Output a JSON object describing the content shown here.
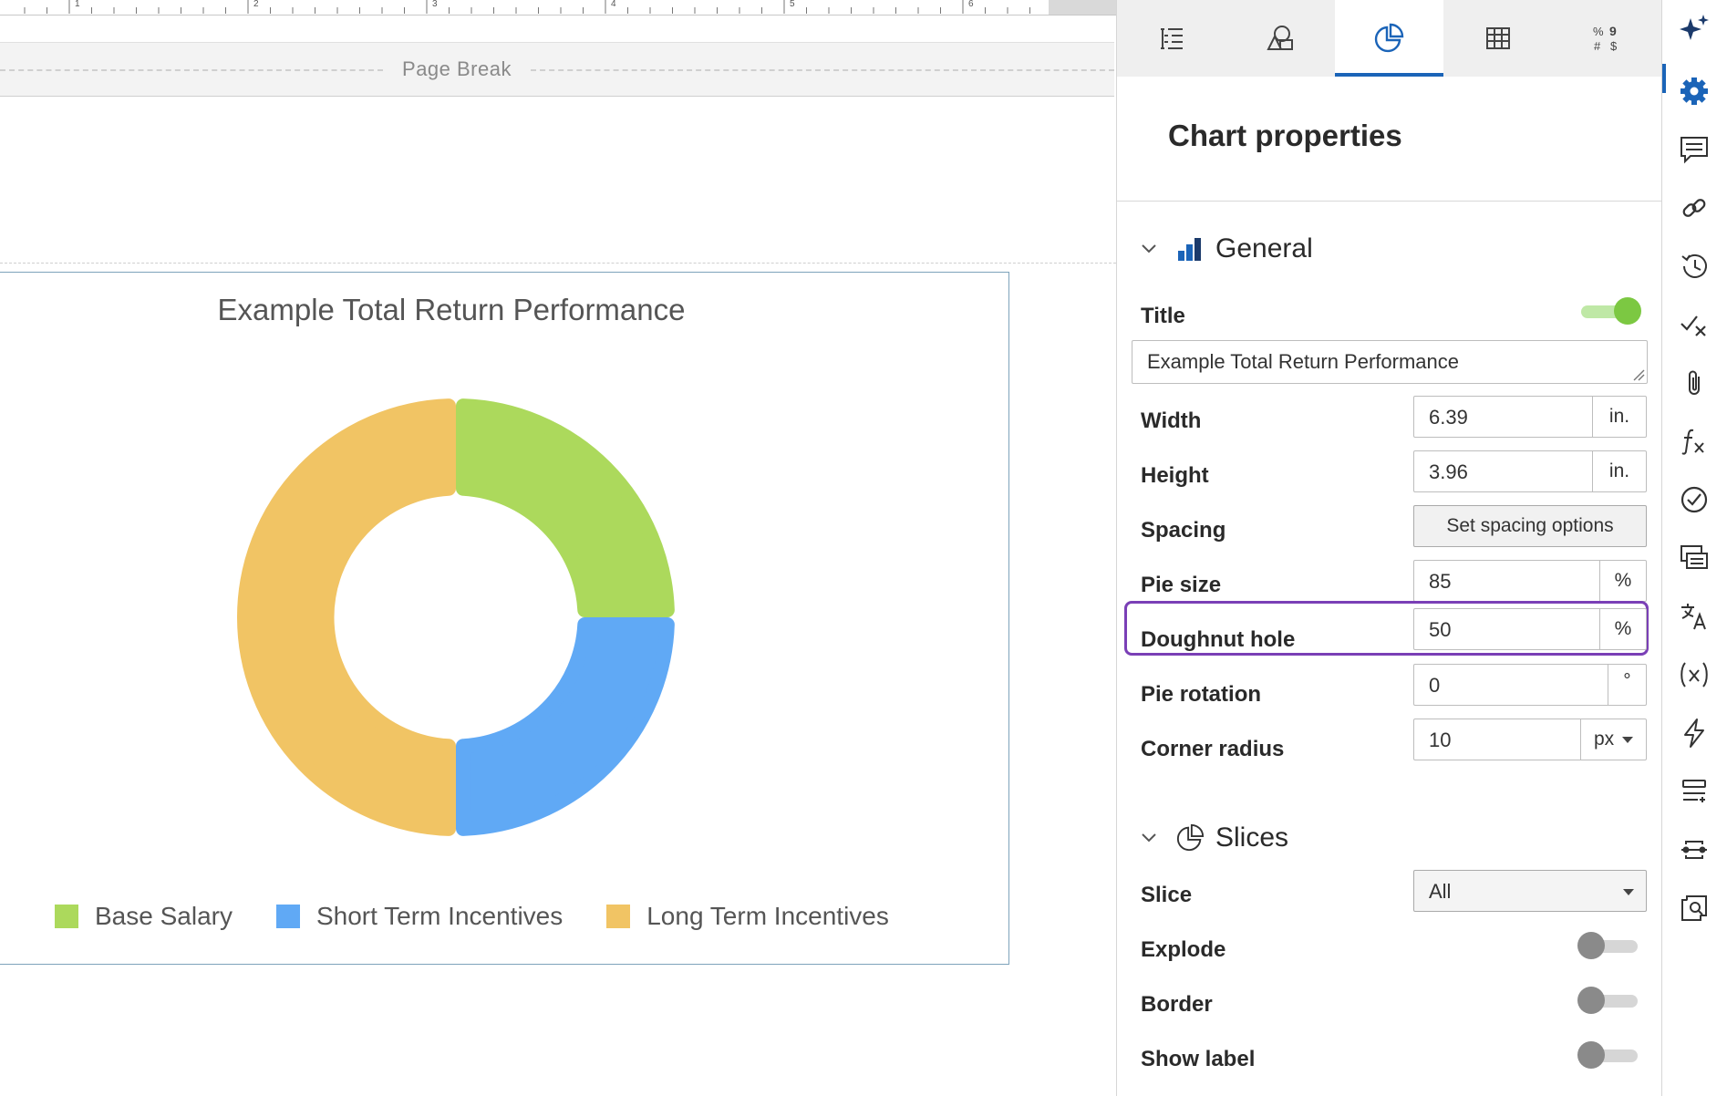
{
  "document": {
    "page_break_label": "Page Break",
    "ruler_numbers": [
      "1",
      "2",
      "3",
      "4",
      "5",
      "6"
    ]
  },
  "chart_data": {
    "type": "pie",
    "subtype": "doughnut",
    "title": "Example Total Return Performance",
    "categories": [
      "Base Salary",
      "Short Term Incentives",
      "Long Term Incentives"
    ],
    "values": [
      25,
      25,
      50
    ],
    "colors": [
      "#acd95c",
      "#60a9f5",
      "#f1c464"
    ],
    "doughnut_hole_percent": 50,
    "pie_size_percent": 85,
    "corner_radius_px": 10,
    "legend_position": "bottom"
  },
  "panel": {
    "tabs": [
      {
        "name": "outline",
        "icon": "list-tree-icon",
        "active": false
      },
      {
        "name": "shapes",
        "icon": "shapes-icon",
        "active": false
      },
      {
        "name": "chart",
        "icon": "pie-chart-icon",
        "active": true
      },
      {
        "name": "table",
        "icon": "table-grid-icon",
        "active": false
      },
      {
        "name": "format",
        "icon": "number-format-icon",
        "active": false
      }
    ],
    "format_tab_glyphs": [
      "%",
      "9",
      "#",
      "$"
    ],
    "title": "Chart properties",
    "general": {
      "label": "General",
      "title_label": "Title",
      "title_enabled": true,
      "title_value": "Example Total Return Performance",
      "width_label": "Width",
      "width_value": "6.39",
      "width_unit": "in.",
      "height_label": "Height",
      "height_value": "3.96",
      "height_unit": "in.",
      "spacing_label": "Spacing",
      "spacing_button": "Set spacing options",
      "pie_size_label": "Pie size",
      "pie_size_value": "85",
      "pie_size_unit": "%",
      "doughnut_hole_label": "Doughnut hole",
      "doughnut_hole_value": "50",
      "doughnut_hole_unit": "%",
      "pie_rotation_label": "Pie rotation",
      "pie_rotation_value": "0",
      "pie_rotation_unit": "°",
      "corner_radius_label": "Corner radius",
      "corner_radius_value": "10",
      "corner_radius_unit": "px"
    },
    "slices": {
      "label": "Slices",
      "slice_label": "Slice",
      "slice_value": "All",
      "explode_label": "Explode",
      "explode_enabled": false,
      "border_label": "Border",
      "border_enabled": false,
      "show_label_label": "Show label",
      "show_label_enabled": false
    }
  },
  "rail": {
    "icons": [
      "sparkle-ai-icon",
      "gear-settings-icon",
      "comment-icon",
      "link-icon",
      "history-icon",
      "spellcheck-icon",
      "attachment-icon",
      "formula-fx-icon",
      "check-circle-icon",
      "comments-list-icon",
      "translate-icon",
      "variable-icon",
      "lightning-icon",
      "list-layout-icon",
      "merge-icon",
      "search-doc-icon"
    ],
    "active_color": "#1b64b8"
  }
}
